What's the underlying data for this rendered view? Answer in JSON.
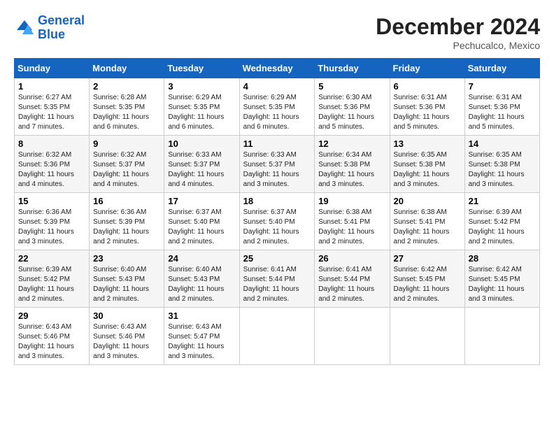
{
  "header": {
    "logo_line1": "General",
    "logo_line2": "Blue",
    "month": "December 2024",
    "location": "Pechucalco, Mexico"
  },
  "weekdays": [
    "Sunday",
    "Monday",
    "Tuesday",
    "Wednesday",
    "Thursday",
    "Friday",
    "Saturday"
  ],
  "weeks": [
    [
      {
        "day": 1,
        "sunrise": "6:27 AM",
        "sunset": "5:35 PM",
        "daylight": "11 hours and 7 minutes."
      },
      {
        "day": 2,
        "sunrise": "6:28 AM",
        "sunset": "5:35 PM",
        "daylight": "11 hours and 6 minutes."
      },
      {
        "day": 3,
        "sunrise": "6:29 AM",
        "sunset": "5:35 PM",
        "daylight": "11 hours and 6 minutes."
      },
      {
        "day": 4,
        "sunrise": "6:29 AM",
        "sunset": "5:35 PM",
        "daylight": "11 hours and 6 minutes."
      },
      {
        "day": 5,
        "sunrise": "6:30 AM",
        "sunset": "5:36 PM",
        "daylight": "11 hours and 5 minutes."
      },
      {
        "day": 6,
        "sunrise": "6:31 AM",
        "sunset": "5:36 PM",
        "daylight": "11 hours and 5 minutes."
      },
      {
        "day": 7,
        "sunrise": "6:31 AM",
        "sunset": "5:36 PM",
        "daylight": "11 hours and 5 minutes."
      }
    ],
    [
      {
        "day": 8,
        "sunrise": "6:32 AM",
        "sunset": "5:36 PM",
        "daylight": "11 hours and 4 minutes."
      },
      {
        "day": 9,
        "sunrise": "6:32 AM",
        "sunset": "5:37 PM",
        "daylight": "11 hours and 4 minutes."
      },
      {
        "day": 10,
        "sunrise": "6:33 AM",
        "sunset": "5:37 PM",
        "daylight": "11 hours and 4 minutes."
      },
      {
        "day": 11,
        "sunrise": "6:33 AM",
        "sunset": "5:37 PM",
        "daylight": "11 hours and 3 minutes."
      },
      {
        "day": 12,
        "sunrise": "6:34 AM",
        "sunset": "5:38 PM",
        "daylight": "11 hours and 3 minutes."
      },
      {
        "day": 13,
        "sunrise": "6:35 AM",
        "sunset": "5:38 PM",
        "daylight": "11 hours and 3 minutes."
      },
      {
        "day": 14,
        "sunrise": "6:35 AM",
        "sunset": "5:38 PM",
        "daylight": "11 hours and 3 minutes."
      }
    ],
    [
      {
        "day": 15,
        "sunrise": "6:36 AM",
        "sunset": "5:39 PM",
        "daylight": "11 hours and 3 minutes."
      },
      {
        "day": 16,
        "sunrise": "6:36 AM",
        "sunset": "5:39 PM",
        "daylight": "11 hours and 2 minutes."
      },
      {
        "day": 17,
        "sunrise": "6:37 AM",
        "sunset": "5:40 PM",
        "daylight": "11 hours and 2 minutes."
      },
      {
        "day": 18,
        "sunrise": "6:37 AM",
        "sunset": "5:40 PM",
        "daylight": "11 hours and 2 minutes."
      },
      {
        "day": 19,
        "sunrise": "6:38 AM",
        "sunset": "5:41 PM",
        "daylight": "11 hours and 2 minutes."
      },
      {
        "day": 20,
        "sunrise": "6:38 AM",
        "sunset": "5:41 PM",
        "daylight": "11 hours and 2 minutes."
      },
      {
        "day": 21,
        "sunrise": "6:39 AM",
        "sunset": "5:42 PM",
        "daylight": "11 hours and 2 minutes."
      }
    ],
    [
      {
        "day": 22,
        "sunrise": "6:39 AM",
        "sunset": "5:42 PM",
        "daylight": "11 hours and 2 minutes."
      },
      {
        "day": 23,
        "sunrise": "6:40 AM",
        "sunset": "5:43 PM",
        "daylight": "11 hours and 2 minutes."
      },
      {
        "day": 24,
        "sunrise": "6:40 AM",
        "sunset": "5:43 PM",
        "daylight": "11 hours and 2 minutes."
      },
      {
        "day": 25,
        "sunrise": "6:41 AM",
        "sunset": "5:44 PM",
        "daylight": "11 hours and 2 minutes."
      },
      {
        "day": 26,
        "sunrise": "6:41 AM",
        "sunset": "5:44 PM",
        "daylight": "11 hours and 2 minutes."
      },
      {
        "day": 27,
        "sunrise": "6:42 AM",
        "sunset": "5:45 PM",
        "daylight": "11 hours and 2 minutes."
      },
      {
        "day": 28,
        "sunrise": "6:42 AM",
        "sunset": "5:45 PM",
        "daylight": "11 hours and 3 minutes."
      }
    ],
    [
      {
        "day": 29,
        "sunrise": "6:43 AM",
        "sunset": "5:46 PM",
        "daylight": "11 hours and 3 minutes."
      },
      {
        "day": 30,
        "sunrise": "6:43 AM",
        "sunset": "5:46 PM",
        "daylight": "11 hours and 3 minutes."
      },
      {
        "day": 31,
        "sunrise": "6:43 AM",
        "sunset": "5:47 PM",
        "daylight": "11 hours and 3 minutes."
      },
      null,
      null,
      null,
      null
    ]
  ]
}
